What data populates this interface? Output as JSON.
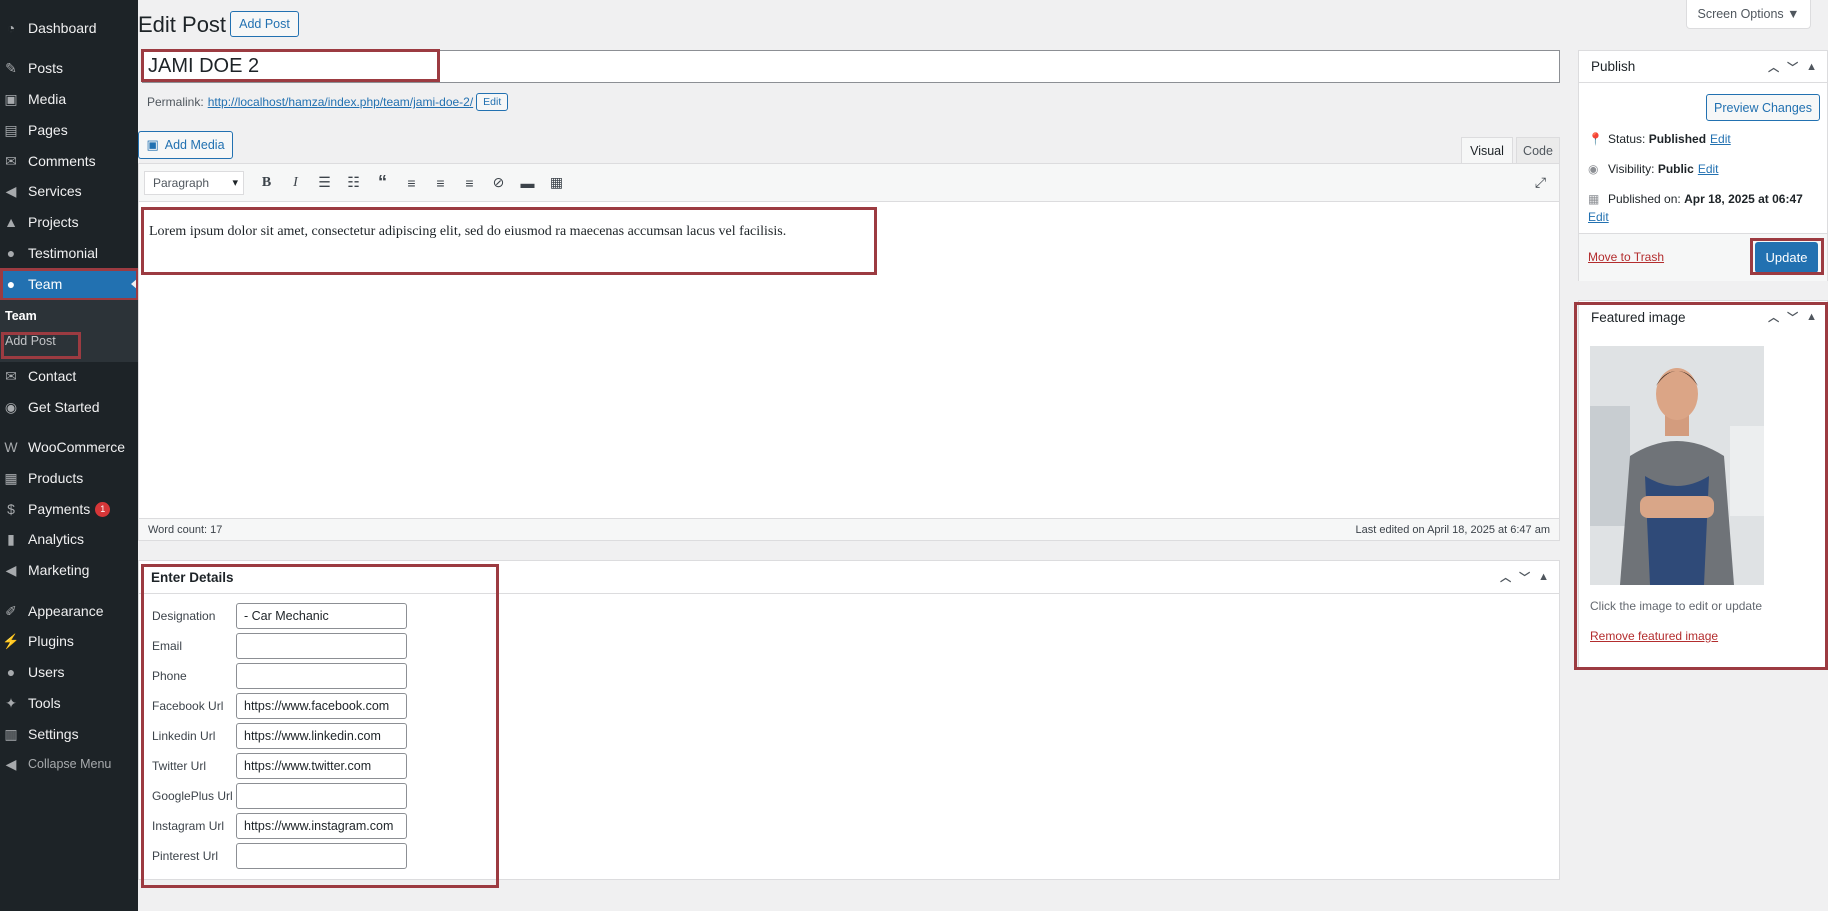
{
  "sidebar": {
    "items": [
      {
        "icon": "dashboard-icon",
        "glyph": "◔",
        "label": "Dashboard"
      },
      {
        "icon": "pin-icon",
        "glyph": "✎",
        "label": "Posts"
      },
      {
        "icon": "media-icon",
        "glyph": "▣",
        "label": "Media"
      },
      {
        "icon": "pages-icon",
        "glyph": "▤",
        "label": "Pages"
      },
      {
        "icon": "comments-icon",
        "glyph": "✉",
        "label": "Comments"
      },
      {
        "icon": "megaphone-icon",
        "glyph": "◀",
        "label": "Services"
      },
      {
        "icon": "graduation-cap-icon",
        "glyph": "▲",
        "label": "Projects"
      },
      {
        "icon": "user-icon",
        "glyph": "●",
        "label": "Testimonial"
      },
      {
        "icon": "users-icon",
        "glyph": "●",
        "label": "Team"
      },
      {
        "icon": "envelope-icon",
        "glyph": "✉",
        "label": "Contact"
      },
      {
        "icon": "palette-icon",
        "glyph": "◉",
        "label": "Get Started"
      },
      {
        "icon": "woocommerce-icon",
        "glyph": "W",
        "label": "WooCommerce"
      },
      {
        "icon": "archive-icon",
        "glyph": "▦",
        "label": "Products"
      },
      {
        "icon": "dollar-icon",
        "glyph": "$",
        "label": "Payments",
        "badge": "1"
      },
      {
        "icon": "bar-chart-icon",
        "glyph": "▮",
        "label": "Analytics"
      },
      {
        "icon": "megaphone-icon",
        "glyph": "◀",
        "label": "Marketing"
      },
      {
        "icon": "brush-icon",
        "glyph": "✐",
        "label": "Appearance"
      },
      {
        "icon": "plugin-icon",
        "glyph": "⚡",
        "label": "Plugins"
      },
      {
        "icon": "users-icon",
        "glyph": "●",
        "label": "Users"
      },
      {
        "icon": "wrench-icon",
        "glyph": "✦",
        "label": "Tools"
      },
      {
        "icon": "settings-icon",
        "glyph": "▥",
        "label": "Settings"
      },
      {
        "icon": "collapse-icon",
        "glyph": "◀",
        "label": "Collapse Menu"
      }
    ],
    "submenu": {
      "head": "Team",
      "add": "Add Post"
    }
  },
  "header": {
    "title": "Edit Post",
    "add_post": "Add Post",
    "screen_options": "Screen Options ▼"
  },
  "post": {
    "title": "JAMI DOE 2",
    "permalink_label": "Permalink:",
    "permalink_url": "http://localhost/hamza/index.php/team/jami-doe-2/",
    "permalink_edit": "Edit"
  },
  "editor": {
    "add_media": "Add Media",
    "tab_visual": "Visual",
    "tab_code": "Code",
    "format": "Paragraph",
    "content": "Lorem ipsum dolor sit amet, consectetur adipiscing elit, sed do eiusmod ra maecenas accumsan lacus vel facilisis.",
    "word_count": "Word count: 17",
    "last_edited": "Last edited on April 18, 2025 at 6:47 am"
  },
  "details": {
    "title": "Enter Details",
    "fields": [
      {
        "label": "Designation",
        "value": " - Car Mechanic"
      },
      {
        "label": "Email",
        "value": ""
      },
      {
        "label": "Phone",
        "value": ""
      },
      {
        "label": "Facebook Url",
        "value": "https://www.facebook.com"
      },
      {
        "label": "Linkedin Url",
        "value": "https://www.linkedin.com"
      },
      {
        "label": "Twitter Url",
        "value": "https://www.twitter.com"
      },
      {
        "label": "GooglePlus Url",
        "value": ""
      },
      {
        "label": "Instagram Url",
        "value": "https://www.instagram.com"
      },
      {
        "label": "Pinterest Url",
        "value": ""
      }
    ]
  },
  "publish": {
    "title": "Publish",
    "preview": "Preview Changes",
    "status_label": "Status:",
    "status_value": "Published",
    "visibility_label": "Visibility:",
    "visibility_value": "Public",
    "published_label": "Published on:",
    "published_value": "Apr 18, 2025 at 06:47",
    "edit": "Edit",
    "trash": "Move to Trash",
    "update": "Update"
  },
  "featured": {
    "title": "Featured image",
    "hint": "Click the image to edit or update",
    "remove": "Remove featured image"
  },
  "colors": {
    "accent": "#2271b1",
    "sidebar": "#1d2327",
    "highlight": "#9c3b41",
    "danger": "#d63638"
  }
}
